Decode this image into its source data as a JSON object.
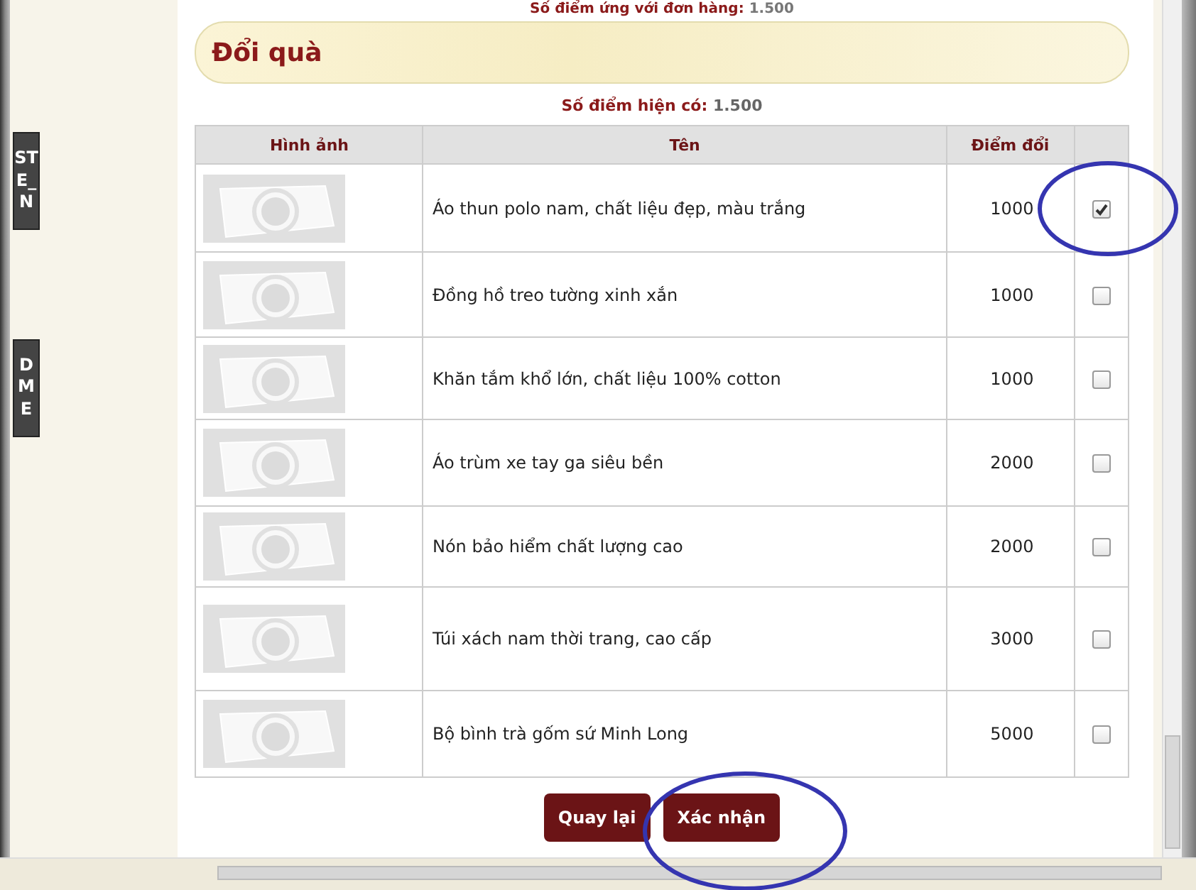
{
  "side_tabs": [
    {
      "label": "STE_N"
    },
    {
      "label": "DME"
    }
  ],
  "order_points": {
    "label": "Số điểm ứng với đơn hàng:",
    "value": "1.500"
  },
  "section_title": "Đổi quà",
  "current_points": {
    "label": "Số điểm hiện có:",
    "value": "1.500"
  },
  "table": {
    "columns": [
      "Hình ảnh",
      "Tên",
      "Điểm đổi"
    ],
    "rows": [
      {
        "name": "Áo thun polo nam, chất liệu đẹp, màu trắng",
        "score": "1000",
        "checked": true,
        "circled": true
      },
      {
        "name": "Đồng hồ treo tường xinh xắn",
        "score": "1000",
        "checked": false,
        "circled": false
      },
      {
        "name": "Khăn tắm khổ lớn, chất liệu 100% cotton",
        "score": "1000",
        "checked": false,
        "circled": false
      },
      {
        "name": "Áo trùm xe tay ga siêu bền",
        "score": "2000",
        "checked": false,
        "circled": false
      },
      {
        "name": "Nón bảo hiểm chất lượng cao",
        "score": "2000",
        "checked": false,
        "circled": false
      },
      {
        "name": "Túi xách nam thời trang, cao cấp",
        "score": "3000",
        "checked": false,
        "circled": false
      },
      {
        "name": "Bộ bình trà gốm sứ Minh Long",
        "score": "5000",
        "checked": false,
        "circled": false
      }
    ]
  },
  "buttons": [
    {
      "label": "Quay lại",
      "circled": false
    },
    {
      "label": "Xác nhận",
      "circled": true
    }
  ]
}
